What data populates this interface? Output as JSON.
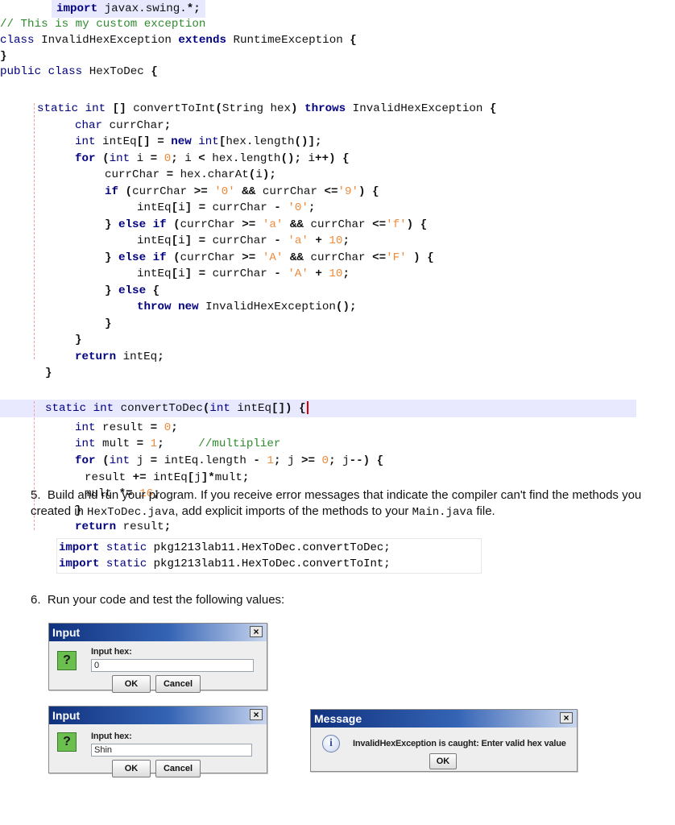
{
  "code_lines": [
    "import javax.swing.*;",
    "// This is my custom exception",
    "class InvalidHexException extends RuntimeException {",
    "}",
    "public class HexToDec {",
    "static int [] convertToInt(String hex) throws InvalidHexException {",
    "char currChar;",
    "int intEq[] = new int[hex.length()];",
    "for (int i = 0; i < hex.length(); i++) {",
    "currChar = hex.charAt(i);",
    "if (currChar >= '0' && currChar <='9') {",
    "intEq[i] = currChar - '0';",
    "} else if (currChar >= 'a' && currChar <='f') {",
    "intEq[i] = currChar - 'a' + 10;",
    "} else if (currChar >= 'A' && currChar <='F' ) {",
    "intEq[i] = currChar - 'A' + 10;",
    "} else {",
    "throw new InvalidHexException();",
    "}",
    "}",
    "return intEq;",
    "}",
    "static int convertToDec(int intEq[]) {",
    "int result = 0;",
    "int mult = 1;     //multiplier",
    "for (int j = intEq.length - 1; j >= 0; j--) {",
    "result += intEq[j]*mult;",
    "mult *= 16;",
    "}",
    "return result;"
  ],
  "instructions": {
    "step5_number": "5.",
    "step5_text_a": "Build and run your program. If you receive error messages that indicate the compiler can't find the methods you created in ",
    "step5_code_a": "HexToDec.java",
    "step5_text_b": ", add explicit imports of the methods to your ",
    "step5_code_b": "Main.java",
    "step5_text_c": " file.",
    "import_kw": "import",
    "static_kw": "static",
    "import1_path": "pkg1213lab11.HexToDec.convertToDec;",
    "import2_path": "pkg1213lab11.HexToDec.convertToInt;",
    "step6_number": "6.",
    "step6_text": "Run your code and test the following values:"
  },
  "dialog1": {
    "title": "Input",
    "prompt": "Input hex:",
    "value": "0",
    "ok": "OK",
    "cancel": "Cancel",
    "close": "×"
  },
  "dialog2": {
    "title": "Input",
    "prompt": "Input hex:",
    "value": "Shin",
    "ok": "OK",
    "cancel": "Cancel",
    "close": "×"
  },
  "dialog3": {
    "title": "Message",
    "message": "InvalidHexException is caught: Enter valid hex value",
    "ok": "OK",
    "close": "×"
  },
  "icons": {
    "question": "question-icon",
    "info": "info-icon",
    "close": "close-icon"
  }
}
